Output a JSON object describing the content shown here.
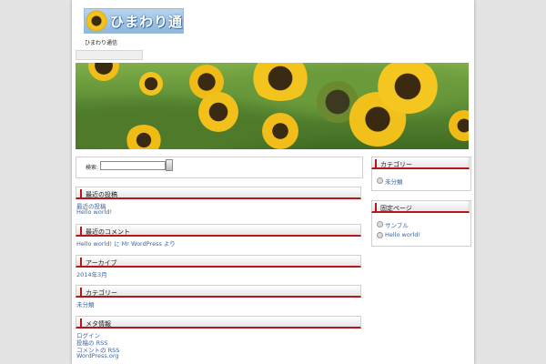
{
  "site": {
    "logo_text": "ひまわり通信",
    "tagline": "ひまわり通信"
  },
  "search": {
    "label": "検索:",
    "placeholder": ""
  },
  "main_widgets": {
    "recent_posts": {
      "title": "最近の投稿",
      "items": [
        "最近の投稿",
        "Hello world!"
      ]
    },
    "recent_comments": {
      "title": "最近のコメント",
      "text": "Hello world! に Mr WordPress より"
    },
    "archives": {
      "title": "アーカイブ",
      "items": [
        "2014年3月"
      ]
    },
    "categories": {
      "title": "カテゴリー",
      "items": [
        "未分類"
      ]
    },
    "meta": {
      "title": "メタ情報",
      "items": [
        "ログイン",
        "投稿の RSS",
        "コメントの RSS",
        "WordPress.org"
      ]
    }
  },
  "sidebar": {
    "categories": {
      "title": "カテゴリー",
      "items": [
        "未分類"
      ]
    },
    "pages": {
      "title": "固定ページ",
      "items": [
        "サンプル",
        "Hello world!"
      ]
    }
  }
}
